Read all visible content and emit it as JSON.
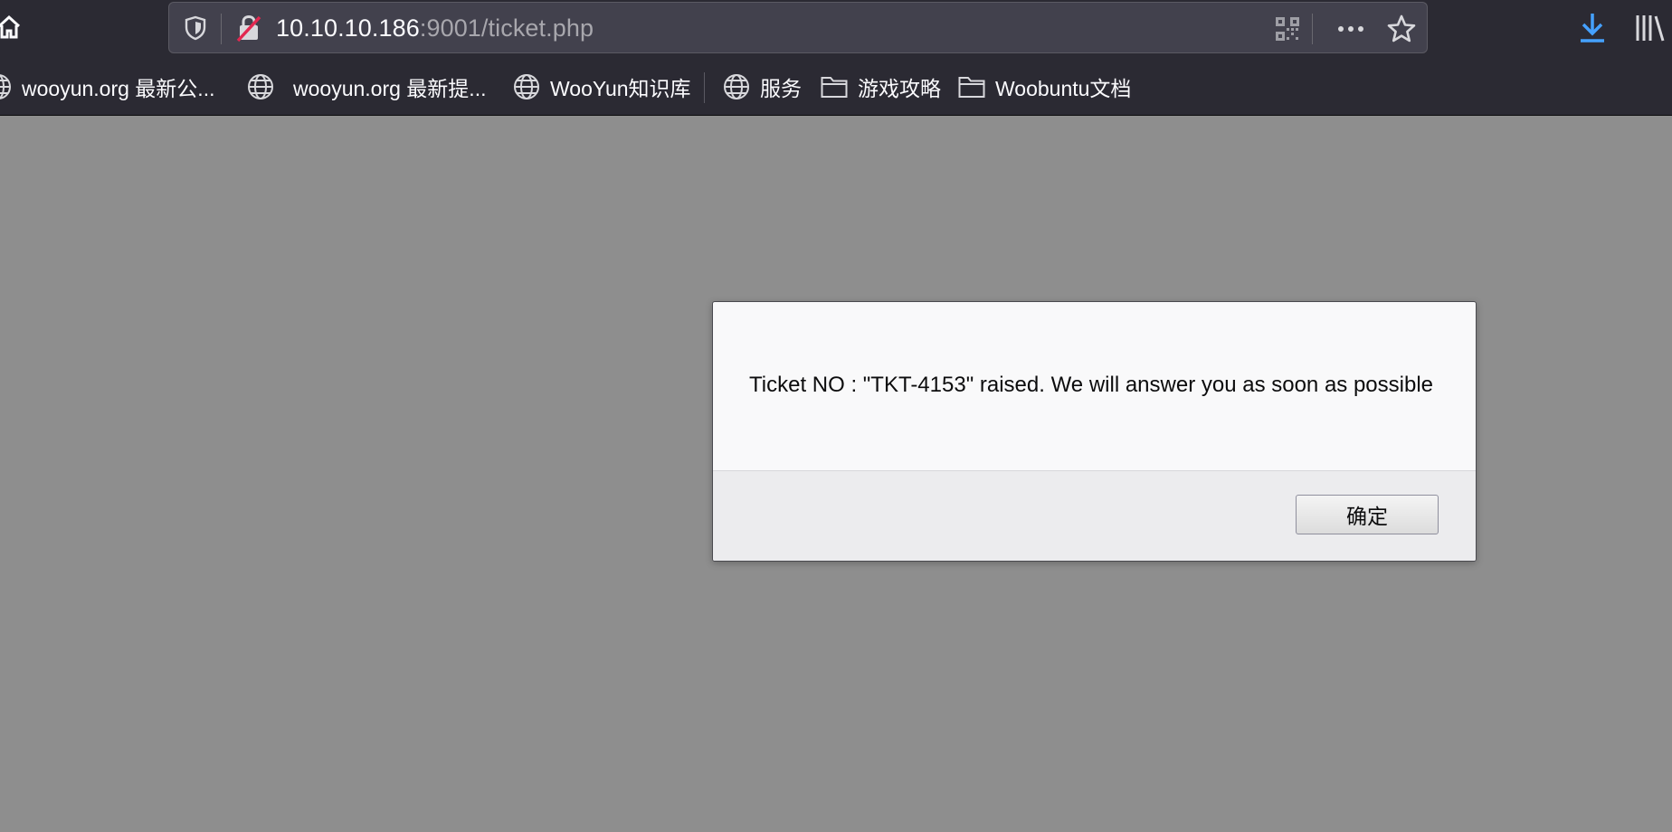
{
  "browser": {
    "url_host": "10.10.10.186",
    "url_rest": ":9001/ticket.php",
    "icons": {
      "home": "home-icon",
      "shield": "tracking-protection-icon",
      "lock": "insecure-lock-icon",
      "qr": "qr-code-icon",
      "more": "more-actions-icon",
      "star": "bookmark-star-icon",
      "download": "download-icon",
      "library": "library-icon"
    },
    "accent_color": "#45a1ff",
    "insecure_color": "#e22850"
  },
  "bookmarks": [
    {
      "label": "wooyun.org 最新公...",
      "icon": "globe-icon"
    },
    {
      "label": "wooyun.org 最新提...",
      "icon": "globe-icon"
    },
    {
      "label": "WooYun知识库",
      "icon": "globe-icon"
    },
    {
      "label": "服务",
      "icon": "globe-icon"
    },
    {
      "label": "游戏攻略",
      "icon": "folder-icon"
    },
    {
      "label": "Woobuntu文档",
      "icon": "folder-icon"
    }
  ],
  "dialog": {
    "message": "Ticket NO : \"TKT-4153\" raised. We will answer you as soon as possible",
    "ok_label": "确定"
  }
}
